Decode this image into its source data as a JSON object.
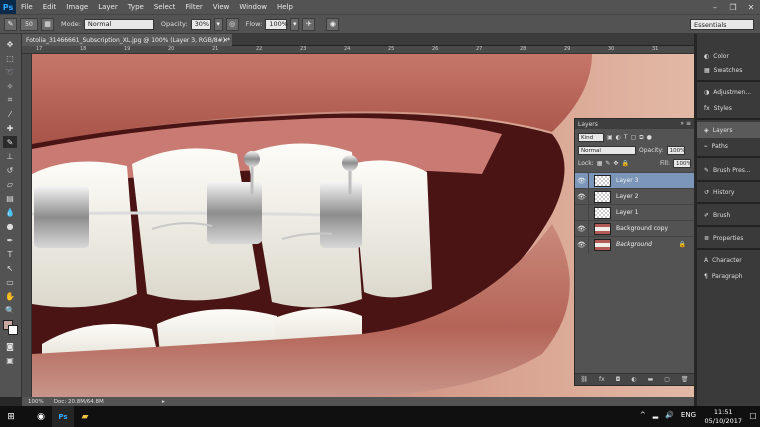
{
  "menubar": {
    "logo": "Ps",
    "items": [
      "File",
      "Edit",
      "Image",
      "Layer",
      "Type",
      "Select",
      "Filter",
      "View",
      "Window",
      "Help"
    ],
    "window_controls": [
      "–",
      "❐",
      "✕"
    ]
  },
  "options": {
    "brush_size": "50",
    "mode_label": "Mode:",
    "mode_value": "Normal",
    "opacity_label": "Opacity:",
    "opacity_value": "30%",
    "flow_label": "Flow:",
    "flow_value": "100%",
    "workspace": "Essentials"
  },
  "document": {
    "tab_title": "Fotolia_31466661_Subscription_XL.jpg @ 100% (Layer 3, RGB/8#) *",
    "ruler_numbers": [
      "17",
      "18",
      "19",
      "20",
      "21",
      "22",
      "23",
      "24",
      "25",
      "26",
      "27",
      "28",
      "29",
      "30",
      "31"
    ],
    "zoom": "100%",
    "doc_size": "Doc: 20.8M/64.8M"
  },
  "layers_panel": {
    "title": "Layers",
    "filter_kind": "Kind",
    "blend_mode": "Normal",
    "opacity_label": "Opacity:",
    "opacity_value": "100%",
    "lock_label": "Lock:",
    "fill_label": "Fill:",
    "fill_value": "100%",
    "layers": [
      {
        "name": "Layer 3",
        "visible": true,
        "selected": true,
        "thumb": "transparent"
      },
      {
        "name": "Layer 2",
        "visible": true,
        "selected": false,
        "thumb": "transparent"
      },
      {
        "name": "Layer 1",
        "visible": false,
        "selected": false,
        "thumb": "transparent"
      },
      {
        "name": "Background copy",
        "visible": true,
        "selected": false,
        "thumb": "photo"
      },
      {
        "name": "Background",
        "visible": true,
        "selected": false,
        "thumb": "photo",
        "locked": true
      }
    ]
  },
  "dock": {
    "items": [
      "Color",
      "Swatches",
      "Adjustmen...",
      "Styles",
      "Layers",
      "Paths",
      "Brush Pres...",
      "History",
      "Brush",
      "Properties",
      "Character",
      "Paragraph"
    ]
  },
  "taskbar": {
    "language": "ENG",
    "time": "11:51",
    "date": "05/10/2017"
  },
  "colors": {
    "accent_selected": "#7b96b8",
    "panel": "#535353",
    "photoshop_blue": "#31a8ff"
  }
}
